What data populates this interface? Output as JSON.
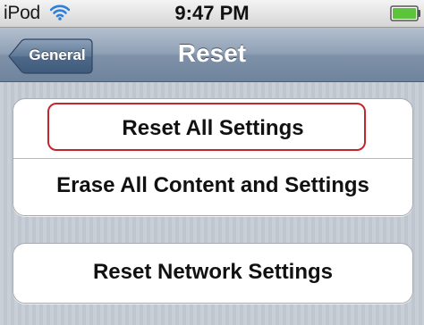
{
  "status_bar": {
    "carrier": "iPod",
    "wifi_icon": "wifi-icon",
    "time": "9:47 PM",
    "battery_icon": "battery-icon",
    "battery_level": 1.0,
    "battery_color": "#5cc43a"
  },
  "nav_bar": {
    "back_label": "General",
    "title": "Reset"
  },
  "groups": [
    {
      "cells": [
        {
          "label": "Reset All Settings",
          "selected": true
        },
        {
          "label": "Erase All Content and Settings"
        }
      ]
    },
    {
      "cells": [
        {
          "label": "Reset Network Settings"
        }
      ]
    }
  ],
  "colors": {
    "selection_outline": "#c4262e",
    "nav_bar": "#7e91a8",
    "background": "#c5ccd4"
  }
}
